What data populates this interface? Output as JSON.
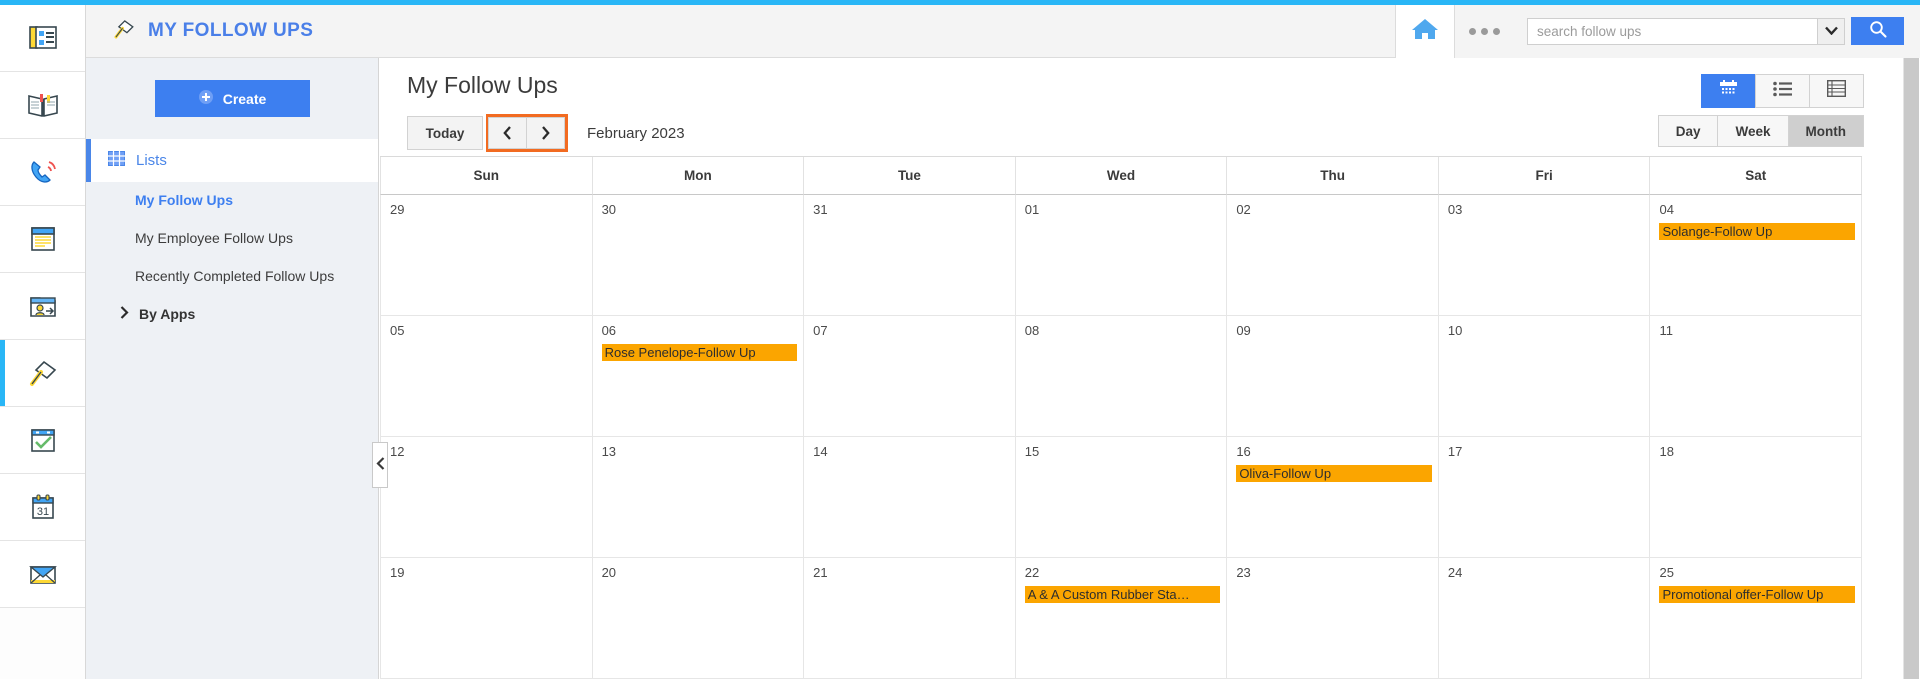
{
  "theme": {
    "accent_blue": "#29b6f6",
    "brand_blue": "#3d7ff0",
    "link_blue": "#4a86e8",
    "event_orange": "#fba500",
    "highlight_orange": "#f26b21"
  },
  "icon_rail": {
    "items": [
      {
        "name": "news-icon",
        "label": "News"
      },
      {
        "name": "book-icon",
        "label": "Knowledge Base"
      },
      {
        "name": "phone-ring-icon",
        "label": "Calls"
      },
      {
        "name": "notes-icon",
        "label": "Notes"
      },
      {
        "name": "contact-transfer-icon",
        "label": "Contacts"
      },
      {
        "name": "pin-icon",
        "label": "Follow Ups"
      },
      {
        "name": "checked-calendar-icon",
        "label": "Tasks"
      },
      {
        "name": "calendar-31-icon",
        "label": "Calendar"
      },
      {
        "name": "envelope-icon",
        "label": "Mail"
      }
    ],
    "active_index": 5
  },
  "header": {
    "title": "MY FOLLOW UPS",
    "pin_icon": "pin-icon",
    "home_icon": "home-icon",
    "more_icon": "more-dots-icon",
    "search": {
      "placeholder": "search follow ups",
      "value": "",
      "dropdown_icon": "chevron-down-icon",
      "search_icon": "search-icon"
    }
  },
  "left_panel": {
    "create_button": {
      "label": "Create",
      "icon": "plus-circle-icon"
    },
    "lists": {
      "label": "Lists",
      "icon": "grid-icon"
    },
    "sub_items": [
      {
        "label": "My Follow Ups",
        "selected": true
      },
      {
        "label": "My Employee Follow Ups",
        "selected": false
      },
      {
        "label": "Recently Completed Follow Ups",
        "selected": false
      }
    ],
    "by_apps": {
      "label": "By Apps",
      "icon": "chevron-right-icon"
    },
    "collapse_handle_icon": "chevron-left-icon"
  },
  "main": {
    "page_title": "My Follow Ups",
    "view_toggle": [
      {
        "name": "calendar-view",
        "icon": "calendar-icon",
        "active": true
      },
      {
        "name": "list-view",
        "icon": "list-icon",
        "active": false
      },
      {
        "name": "table-view",
        "icon": "table-icon",
        "active": false
      }
    ],
    "nav": {
      "today_label": "Today",
      "prev_icon": "chevron-left-icon",
      "next_icon": "chevron-right-icon",
      "month_label": "February 2023",
      "arrows_highlighted": true
    },
    "range_toggle": [
      {
        "label": "Day",
        "active": false
      },
      {
        "label": "Week",
        "active": false
      },
      {
        "label": "Month",
        "active": true
      }
    ]
  },
  "calendar": {
    "weekday_headers": [
      "Sun",
      "Mon",
      "Tue",
      "Wed",
      "Thu",
      "Fri",
      "Sat"
    ],
    "weeks": [
      [
        {
          "day": "29",
          "events": []
        },
        {
          "day": "30",
          "events": []
        },
        {
          "day": "31",
          "events": []
        },
        {
          "day": "01",
          "events": []
        },
        {
          "day": "02",
          "events": []
        },
        {
          "day": "03",
          "events": []
        },
        {
          "day": "04",
          "events": [
            "Solange-Follow Up"
          ]
        }
      ],
      [
        {
          "day": "05",
          "events": []
        },
        {
          "day": "06",
          "events": [
            "Rose Penelope-Follow Up"
          ]
        },
        {
          "day": "07",
          "events": []
        },
        {
          "day": "08",
          "events": []
        },
        {
          "day": "09",
          "events": []
        },
        {
          "day": "10",
          "events": []
        },
        {
          "day": "11",
          "events": []
        }
      ],
      [
        {
          "day": "12",
          "events": []
        },
        {
          "day": "13",
          "events": []
        },
        {
          "day": "14",
          "events": []
        },
        {
          "day": "15",
          "events": []
        },
        {
          "day": "16",
          "events": [
            "Oliva-Follow Up"
          ]
        },
        {
          "day": "17",
          "events": []
        },
        {
          "day": "18",
          "events": []
        }
      ],
      [
        {
          "day": "19",
          "events": []
        },
        {
          "day": "20",
          "events": []
        },
        {
          "day": "21",
          "events": []
        },
        {
          "day": "22",
          "events": [
            "A & A Custom Rubber Sta…"
          ]
        },
        {
          "day": "23",
          "events": []
        },
        {
          "day": "24",
          "events": []
        },
        {
          "day": "25",
          "events": [
            "Promotional offer-Follow Up"
          ]
        }
      ]
    ]
  }
}
